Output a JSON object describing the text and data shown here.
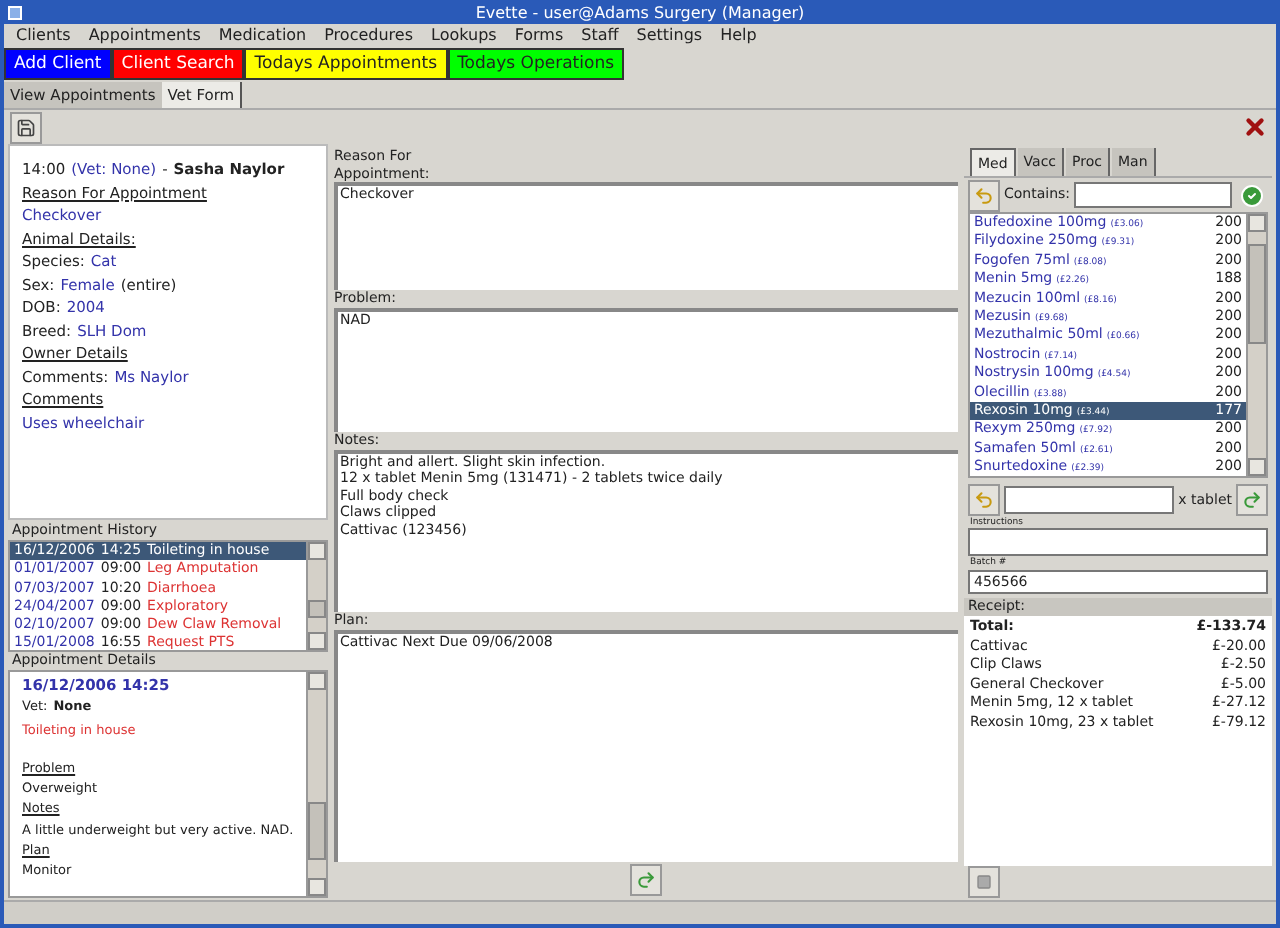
{
  "window": {
    "title": "Evette - user@Adams Surgery (Manager)"
  },
  "menu": [
    "Clients",
    "Appointments",
    "Medication",
    "Procedures",
    "Lookups",
    "Forms",
    "Staff",
    "Settings",
    "Help"
  ],
  "quick_buttons": [
    {
      "label": "Add Client",
      "color": "#0000ff"
    },
    {
      "label": "Client Search",
      "color": "#ff0000"
    },
    {
      "label": "Todays Appointments",
      "color": "#ffff00"
    },
    {
      "label": "Todays Operations",
      "color": "#00ff00"
    }
  ],
  "tabs": [
    {
      "label": "View Appointments",
      "selected": false
    },
    {
      "label": "Vet Form",
      "selected": true
    }
  ],
  "info": {
    "time": "14:00",
    "vet": "(Vet: None)",
    "separator": "-",
    "client": "Sasha Naylor",
    "lines": [
      {
        "kind": "heading",
        "text": "Reason For Appointment"
      },
      {
        "kind": "value",
        "text": "Checkover"
      },
      {
        "kind": "heading",
        "text": "Animal Details:"
      },
      {
        "kind": "field",
        "label": "Species:",
        "value": "Cat"
      },
      {
        "kind": "field",
        "label": "Sex:",
        "value": "Female",
        "note": "(entire)"
      },
      {
        "kind": "field",
        "label": "DOB:",
        "value": "2004"
      },
      {
        "kind": "field",
        "label": "Breed:",
        "value": "SLH Dom"
      },
      {
        "kind": "heading",
        "text": "Owner Details"
      },
      {
        "kind": "field",
        "label": "Comments:",
        "value": "Ms Naylor"
      },
      {
        "kind": "heading",
        "text": "Comments"
      },
      {
        "kind": "value",
        "text": "Uses wheelchair"
      }
    ]
  },
  "history": {
    "label": "Appointment History",
    "rows": [
      {
        "date": "16/12/2006",
        "time": "14:25",
        "title": "Toileting in house",
        "selected": true
      },
      {
        "date": "01/01/2007",
        "time": "09:00",
        "title": "Leg Amputation",
        "selected": false
      },
      {
        "date": "07/03/2007",
        "time": "10:20",
        "title": "Diarrhoea",
        "selected": false
      },
      {
        "date": "24/04/2007",
        "time": "09:00",
        "title": "Exploratory",
        "selected": false
      },
      {
        "date": "02/10/2007",
        "time": "09:00",
        "title": "Dew Claw Removal",
        "selected": false
      },
      {
        "date": "15/01/2008",
        "time": "16:55",
        "title": "Request PTS",
        "selected": false
      }
    ]
  },
  "details": {
    "label": "Appointment Details",
    "date": "16/12/2006 14:25",
    "vet_label": "Vet:",
    "vet": "None",
    "reason": "Toileting in house",
    "sections": [
      {
        "heading": "Problem",
        "text": "Overweight"
      },
      {
        "heading": "Notes",
        "text": "A little underweight but very active. NAD."
      },
      {
        "heading": "Plan",
        "text": "Monitor"
      }
    ]
  },
  "form": [
    {
      "label": "Reason For Appointment:",
      "lines": [
        "Checkover"
      ]
    },
    {
      "label": "Problem:",
      "lines": [
        "NAD"
      ]
    },
    {
      "label": "Notes:",
      "lines": [
        "Bright and allert. Slight skin infection.",
        "12 x tablet Menin 5mg (131471) - 2 tablets twice daily",
        "Full body check",
        "Claws clipped",
        "Cattivac (123456)"
      ]
    },
    {
      "label": "Plan:",
      "lines": [
        "Cattivac Next Due 09/06/2008"
      ]
    }
  ],
  "med_tabs": [
    {
      "label": "Med",
      "selected": true
    },
    {
      "label": "Vacc",
      "selected": false
    },
    {
      "label": "Proc",
      "selected": false
    },
    {
      "label": "Man",
      "selected": false
    }
  ],
  "contains_label": "Contains:",
  "medications": [
    {
      "name": "Bufedoxine 100mg",
      "price": "(£3.06)",
      "stock": "200",
      "selected": false
    },
    {
      "name": "Filydoxine 250mg",
      "price": "(£9.31)",
      "stock": "200",
      "selected": false
    },
    {
      "name": "Fogofen 75ml",
      "price": "(£8.08)",
      "stock": "200",
      "selected": false
    },
    {
      "name": "Menin 5mg",
      "price": "(£2.26)",
      "stock": "188",
      "selected": false
    },
    {
      "name": "Mezucin 100ml",
      "price": "(£8.16)",
      "stock": "200",
      "selected": false
    },
    {
      "name": "Mezusin",
      "price": "(£9.68)",
      "stock": "200",
      "selected": false
    },
    {
      "name": "Mezuthalmic 50ml",
      "price": "(£0.66)",
      "stock": "200",
      "selected": false
    },
    {
      "name": "Nostrocin",
      "price": "(£7.14)",
      "stock": "200",
      "selected": false
    },
    {
      "name": "Nostrysin 100mg",
      "price": "(£4.54)",
      "stock": "200",
      "selected": false
    },
    {
      "name": "Olecillin",
      "price": "(£3.88)",
      "stock": "200",
      "selected": false
    },
    {
      "name": "Rexosin 10mg",
      "price": "(£3.44)",
      "stock": "177",
      "selected": true
    },
    {
      "name": "Rexym 250mg",
      "price": "(£7.92)",
      "stock": "200",
      "selected": false
    },
    {
      "name": "Samafen 50ml",
      "price": "(£2.61)",
      "stock": "200",
      "selected": false
    },
    {
      "name": "Snurtedoxine",
      "price": "(£2.39)",
      "stock": "200",
      "selected": false
    }
  ],
  "quantity_unit": "x tablet",
  "instructions_label": "Instructions",
  "batch": {
    "label": "Batch #",
    "value": "456566"
  },
  "receipt": {
    "label": "Receipt:",
    "total_label": "Total:",
    "total": "£-133.74",
    "items": [
      {
        "name": "Cattivac",
        "amount": "£-20.00"
      },
      {
        "name": "Clip Claws",
        "amount": "£-2.50"
      },
      {
        "name": "General Checkover",
        "amount": "£-5.00"
      },
      {
        "name": "Menin 5mg, 12 x tablet",
        "amount": "£-27.12"
      },
      {
        "name": "Rexosin 10mg, 23 x tablet",
        "amount": "£-79.12"
      }
    ]
  }
}
